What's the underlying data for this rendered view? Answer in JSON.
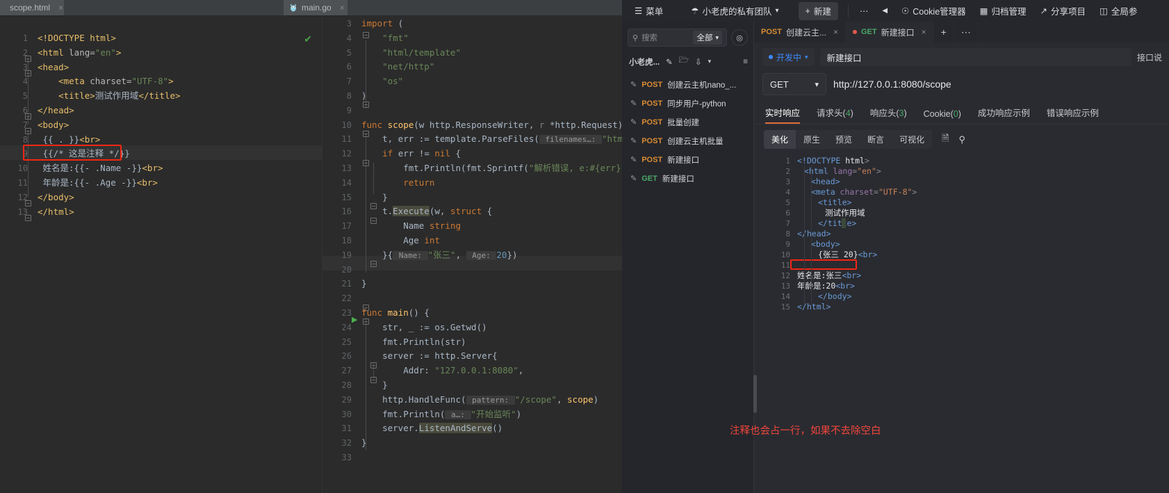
{
  "ide": {
    "tabs": [
      {
        "label": "scope.html",
        "icon": "html-file-icon",
        "active": true
      },
      {
        "label": "main.go",
        "icon": "go-gopher-icon",
        "active": false
      }
    ],
    "close_glyph": "×",
    "left_editor": {
      "name": "scope.html",
      "start_line": 1,
      "lines": [
        {
          "n": "1",
          "parts": [
            {
              "t": "<!DOCTYPE html>",
              "c": "t-tag"
            }
          ]
        },
        {
          "n": "2",
          "parts": [
            {
              "t": "<html ",
              "c": "t-tag"
            },
            {
              "t": "lang=",
              "c": "t-attr"
            },
            {
              "t": "\"en\"",
              "c": "t-str"
            },
            {
              "t": ">",
              "c": "t-tag"
            }
          ]
        },
        {
          "n": "3",
          "parts": [
            {
              "t": "<head>",
              "c": "t-tag"
            }
          ]
        },
        {
          "n": "4",
          "parts": [
            {
              "t": "    <meta ",
              "c": "t-tag"
            },
            {
              "t": "charset=",
              "c": "t-attr"
            },
            {
              "t": "\"UTF-8\"",
              "c": "t-str"
            },
            {
              "t": ">",
              "c": "t-tag"
            }
          ]
        },
        {
          "n": "5",
          "parts": [
            {
              "t": "    <title>",
              "c": "t-tag"
            },
            {
              "t": "测试作用域",
              "c": "t-txt"
            },
            {
              "t": "</title>",
              "c": "t-tag"
            }
          ]
        },
        {
          "n": "6",
          "parts": [
            {
              "t": "</head>",
              "c": "t-tag"
            }
          ]
        },
        {
          "n": "7",
          "parts": [
            {
              "t": "<body>",
              "c": "t-tag"
            }
          ]
        },
        {
          "n": "8",
          "parts": [
            {
              "t": " {{ . }}",
              "c": "t-txt"
            },
            {
              "t": "<br>",
              "c": "t-tag"
            }
          ]
        },
        {
          "n": "9",
          "parts": [
            {
              "t": " {{/* 这是注释 */}}",
              "c": "t-txt"
            }
          ]
        },
        {
          "n": "10",
          "parts": [
            {
              "t": " 姓名是:{{- .Name -}}",
              "c": "t-txt"
            },
            {
              "t": "<br>",
              "c": "t-tag"
            }
          ]
        },
        {
          "n": "11",
          "parts": [
            {
              "t": " 年龄是:{{- .Age -}}",
              "c": "t-txt"
            },
            {
              "t": "<br>",
              "c": "t-tag"
            }
          ]
        },
        {
          "n": "12",
          "parts": [
            {
              "t": "</body>",
              "c": "t-tag"
            }
          ]
        },
        {
          "n": "13",
          "parts": [
            {
              "t": "</html>",
              "c": "t-tag"
            }
          ]
        }
      ],
      "highlighted_line_index": 8,
      "check_mark": "✔",
      "annotation_box": "comment-line-highlight"
    },
    "right_editor": {
      "name": "main.go",
      "lines": [
        {
          "n": "3",
          "parts": [
            {
              "t": "import",
              "c": "t-kw"
            },
            {
              "t": " (",
              "c": "t-brace"
            }
          ]
        },
        {
          "n": "4",
          "parts": [
            {
              "t": "    \"fmt\"",
              "c": "t-str"
            }
          ]
        },
        {
          "n": "5",
          "parts": [
            {
              "t": "    \"html/template\"",
              "c": "t-str"
            }
          ]
        },
        {
          "n": "6",
          "parts": [
            {
              "t": "    \"net/http\"",
              "c": "t-str"
            }
          ]
        },
        {
          "n": "7",
          "parts": [
            {
              "t": "    \"os\"",
              "c": "t-str"
            }
          ]
        },
        {
          "n": "8",
          "parts": [
            {
              "t": ")",
              "c": "t-brace"
            }
          ]
        },
        {
          "n": "9",
          "parts": []
        },
        {
          "n": "10",
          "parts": [
            {
              "t": "func ",
              "c": "t-kw"
            },
            {
              "t": "scope",
              "c": "t-fn"
            },
            {
              "t": "(w http.ResponseWriter, ",
              "c": "t-type"
            },
            {
              "t": "r",
              "c": "t-dim"
            },
            {
              "t": " *http.Request) {",
              "c": "t-type"
            }
          ]
        },
        {
          "n": "11",
          "parts": [
            {
              "t": "    t, err := template.ParseFiles(",
              "c": "t-type"
            },
            {
              "t": " filenames…: ",
              "c": "t-param"
            },
            {
              "t": "\"html/scope.",
              "c": "t-str"
            }
          ]
        },
        {
          "n": "12",
          "parts": [
            {
              "t": "    ",
              "c": "t-type"
            },
            {
              "t": "if",
              "c": "t-kw"
            },
            {
              "t": " err != ",
              "c": "t-type"
            },
            {
              "t": "nil",
              "c": "t-kw"
            },
            {
              "t": " {",
              "c": "t-type"
            }
          ]
        },
        {
          "n": "13",
          "parts": [
            {
              "t": "        fmt.Println(fmt.Sprintf(",
              "c": "t-type"
            },
            {
              "t": "\"解析错误, e:#{err}\"",
              "c": "t-str"
            },
            {
              "t": "))",
              "c": "t-type"
            }
          ]
        },
        {
          "n": "14",
          "parts": [
            {
              "t": "        ",
              "c": "t-type"
            },
            {
              "t": "return",
              "c": "t-kw"
            }
          ]
        },
        {
          "n": "15",
          "parts": [
            {
              "t": "    }",
              "c": "t-type"
            }
          ]
        },
        {
          "n": "16",
          "parts": [
            {
              "t": "    t.",
              "c": "t-type"
            },
            {
              "t": "Execute",
              "c": "t-mark"
            },
            {
              "t": "(w, ",
              "c": "t-type"
            },
            {
              "t": "struct",
              "c": "t-kw"
            },
            {
              "t": " {",
              "c": "t-type"
            }
          ]
        },
        {
          "n": "17",
          "parts": [
            {
              "t": "        Name ",
              "c": "t-type"
            },
            {
              "t": "string",
              "c": "t-kw"
            }
          ]
        },
        {
          "n": "18",
          "parts": [
            {
              "t": "        Age ",
              "c": "t-type"
            },
            {
              "t": "int",
              "c": "t-kw"
            }
          ]
        },
        {
          "n": "19",
          "parts": [
            {
              "t": "    }{",
              "c": "t-type"
            },
            {
              "t": " Name: ",
              "c": "t-param"
            },
            {
              "t": "\"张三\"",
              "c": "t-str"
            },
            {
              "t": ", ",
              "c": "t-type"
            },
            {
              "t": " Age: ",
              "c": "t-param"
            },
            {
              "t": "20",
              "c": "t-num"
            },
            {
              "t": "})",
              "c": "t-type"
            }
          ]
        },
        {
          "n": "20",
          "parts": []
        },
        {
          "n": "21",
          "parts": [
            {
              "t": "}",
              "c": "t-type"
            }
          ]
        },
        {
          "n": "22",
          "parts": []
        },
        {
          "n": "23",
          "parts": [
            {
              "t": "func ",
              "c": "t-kw"
            },
            {
              "t": "main",
              "c": "t-fn"
            },
            {
              "t": "() {",
              "c": "t-type"
            }
          ]
        },
        {
          "n": "24",
          "parts": [
            {
              "t": "    str, _ := os.Getwd()",
              "c": "t-type"
            }
          ]
        },
        {
          "n": "25",
          "parts": [
            {
              "t": "    fmt.Println(str)",
              "c": "t-type"
            }
          ]
        },
        {
          "n": "26",
          "parts": [
            {
              "t": "    server := http.Server{",
              "c": "t-type"
            }
          ]
        },
        {
          "n": "27",
          "parts": [
            {
              "t": "        Addr: ",
              "c": "t-type"
            },
            {
              "t": "\"127.0.0.1:8080\"",
              "c": "t-str"
            },
            {
              "t": ",",
              "c": "t-type"
            }
          ]
        },
        {
          "n": "28",
          "parts": [
            {
              "t": "    }",
              "c": "t-type"
            }
          ]
        },
        {
          "n": "29",
          "parts": [
            {
              "t": "    http.HandleFunc(",
              "c": "t-type"
            },
            {
              "t": " pattern: ",
              "c": "t-param"
            },
            {
              "t": "\"/scope\"",
              "c": "t-str"
            },
            {
              "t": ", ",
              "c": "t-type"
            },
            {
              "t": "scope",
              "c": "t-fn"
            },
            {
              "t": ")",
              "c": "t-type"
            }
          ]
        },
        {
          "n": "30",
          "parts": [
            {
              "t": "    fmt.Println(",
              "c": "t-type"
            },
            {
              "t": " a…: ",
              "c": "t-param"
            },
            {
              "t": "\"开始监听\"",
              "c": "t-str"
            },
            {
              "t": ")",
              "c": "t-type"
            }
          ]
        },
        {
          "n": "31",
          "parts": [
            {
              "t": "    server.",
              "c": "t-type"
            },
            {
              "t": "ListenAndServe",
              "c": "t-mark"
            },
            {
              "t": "()",
              "c": "t-type"
            }
          ]
        },
        {
          "n": "32",
          "parts": [
            {
              "t": "}",
              "c": "t-type"
            }
          ]
        },
        {
          "n": "33",
          "parts": []
        }
      ],
      "run_arrow_line": "23",
      "highlighted_line": "19"
    }
  },
  "api": {
    "topbar": {
      "menu": "菜单",
      "menu_icon": "hamburger-icon",
      "team": "小老虎的私有团队",
      "team_icon": "team-icon",
      "new": "新建",
      "new_icon": "plus-icon",
      "more": "⋯",
      "back_icon": "◀",
      "cookie_manager": "Cookie管理器",
      "cookie_icon": "cookie-icon",
      "archive_manager": "归档管理",
      "archive_icon": "archive-icon",
      "share_project": "分享项目",
      "share_icon": "share-icon",
      "global_label": "全局参",
      "global_icon": "global-icon"
    },
    "sidebar": {
      "search_placeholder": "搜索",
      "search_icon": "search-icon",
      "filter_label": "全部",
      "locate_icon": "locate-icon",
      "project_name": "小老虎...",
      "tool_icons": [
        "add-api-icon",
        "new-folder-icon",
        "import-icon",
        "chevron-down-icon",
        "collapse-icon"
      ],
      "items": [
        {
          "method": "POST",
          "name": "创建云主机nano_..."
        },
        {
          "method": "POST",
          "name": "同步用户-python"
        },
        {
          "method": "POST",
          "name": "批量创建"
        },
        {
          "method": "POST",
          "name": "创建云主机批量"
        },
        {
          "method": "POST",
          "name": "新建接口"
        },
        {
          "method": "GET",
          "name": "新建接口"
        }
      ]
    },
    "request": {
      "tabs": [
        {
          "method": "POST",
          "label": "创建云主...",
          "active": false,
          "dirty": false
        },
        {
          "method": "GET",
          "label": "新建接口",
          "active": true,
          "dirty": true
        }
      ],
      "tab_close": "×",
      "tab_add": "+",
      "tab_more": "⋯",
      "status": "开发中",
      "api_name": "新建接口",
      "api_desc": "接口说",
      "method": "GET",
      "url": "http://127.0.0.1:8080/scope"
    },
    "response": {
      "tabs": [
        {
          "label": "实时响应",
          "count": null,
          "active": true
        },
        {
          "label": "请求头",
          "count": "4",
          "active": false
        },
        {
          "label": "响应头",
          "count": "3",
          "active": false
        },
        {
          "label": "Cookie",
          "count": "0",
          "active": false
        },
        {
          "label": "成功响应示例",
          "count": null,
          "active": false
        },
        {
          "label": "错误响应示例",
          "count": null,
          "active": false
        }
      ],
      "views": [
        {
          "label": "美化",
          "active": true
        },
        {
          "label": "原生",
          "active": false
        },
        {
          "label": "预览",
          "active": false
        },
        {
          "label": "断言",
          "active": false
        },
        {
          "label": "可视化",
          "active": false
        }
      ],
      "copy_icon": "copy-icon",
      "search_icon": "search-icon",
      "body_lines": [
        {
          "n": "1",
          "indent": 0,
          "parts": [
            {
              "t": "<!DOCTYPE",
              "c": "h-tag"
            },
            {
              "t": " ",
              "c": "h-punct"
            },
            {
              "t": "html",
              "c": "h-txt"
            },
            {
              "t": ">",
              "c": "h-punct"
            }
          ]
        },
        {
          "n": "2",
          "indent": 1,
          "parts": [
            {
              "t": "<html ",
              "c": "h-tag"
            },
            {
              "t": "lang",
              "c": "h-attr"
            },
            {
              "t": "=",
              "c": "h-punct"
            },
            {
              "t": "\"en\"",
              "c": "h-str"
            },
            {
              "t": ">",
              "c": "h-punct"
            }
          ]
        },
        {
          "n": "3",
          "indent": 2,
          "parts": [
            {
              "t": "<head>",
              "c": "h-tag"
            }
          ]
        },
        {
          "n": "4",
          "indent": 2,
          "parts": [
            {
              "t": "<meta ",
              "c": "h-tag"
            },
            {
              "t": "charset",
              "c": "h-attr"
            },
            {
              "t": "=",
              "c": "h-punct"
            },
            {
              "t": "\"UTF-8\"",
              "c": "h-str"
            },
            {
              "t": ">",
              "c": "h-punct"
            }
          ]
        },
        {
          "n": "5",
          "indent": 3,
          "parts": [
            {
              "t": "<title>",
              "c": "h-tag"
            }
          ]
        },
        {
          "n": "6",
          "indent": 4,
          "parts": [
            {
              "t": "测试作用域",
              "c": "h-txt"
            }
          ]
        },
        {
          "n": "7",
          "indent": 3,
          "parts": [
            {
              "t": "</title>",
              "c": "h-tag"
            }
          ]
        },
        {
          "n": "8",
          "indent": 0,
          "parts": [
            {
              "t": "</head>",
              "c": "h-tag"
            }
          ]
        },
        {
          "n": "9",
          "indent": 2,
          "parts": [
            {
              "t": "<body>",
              "c": "h-tag"
            }
          ]
        },
        {
          "n": "10",
          "indent": 3,
          "parts": [
            {
              "t": "{张三 20}",
              "c": "h-txt"
            },
            {
              "t": "<br>",
              "c": "h-tag"
            }
          ]
        },
        {
          "n": "11",
          "indent": 0,
          "parts": []
        },
        {
          "n": "12",
          "indent": 0,
          "parts": [
            {
              "t": "姓名是:张三",
              "c": "h-txt"
            },
            {
              "t": "<br>",
              "c": "h-tag"
            }
          ]
        },
        {
          "n": "13",
          "indent": 0,
          "parts": [
            {
              "t": "年龄是:20",
              "c": "h-txt"
            },
            {
              "t": "<br>",
              "c": "h-tag"
            }
          ]
        },
        {
          "n": "14",
          "indent": 3,
          "parts": [
            {
              "t": "</body>",
              "c": "h-tag"
            }
          ]
        },
        {
          "n": "15",
          "indent": 0,
          "parts": [
            {
              "t": "</html>",
              "c": "h-tag"
            }
          ]
        }
      ],
      "highlight_line": "11",
      "annotation": "注释也会占一行，如果不去除空白"
    }
  }
}
